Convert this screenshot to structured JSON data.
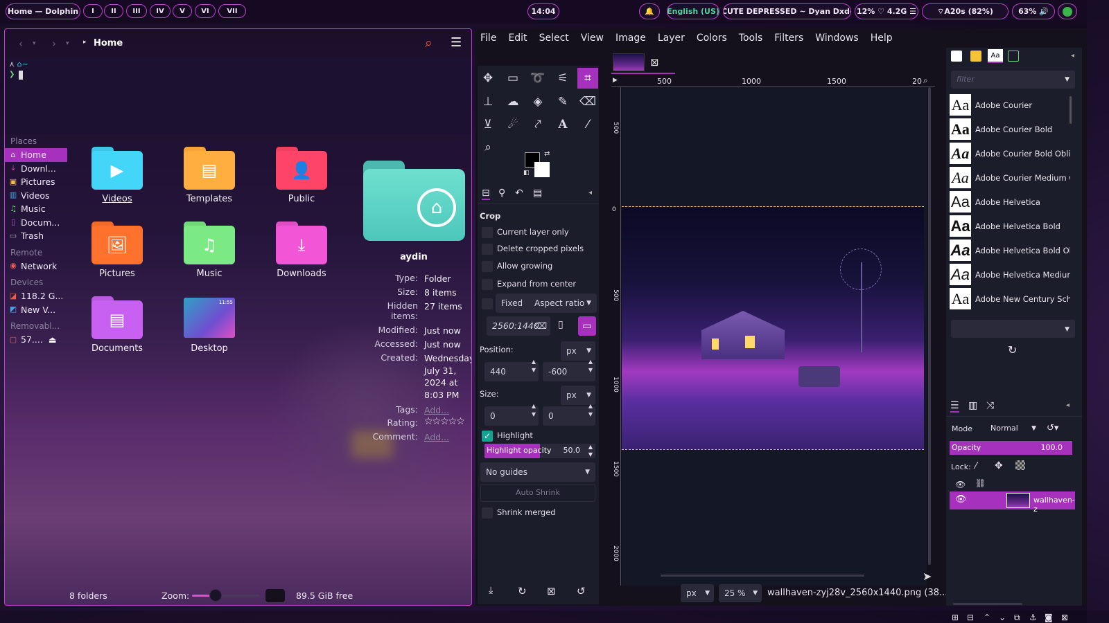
{
  "topbar": {
    "window_title": "Home — Dolphin",
    "workspaces": [
      "I",
      "II",
      "III",
      "IV",
      "V",
      "VI",
      "VII"
    ],
    "clock": "14:04",
    "keyboard": "English (US)",
    "now_playing": "♪ CUTE DEPRESSED ~ Dyan Dxddy",
    "cpu_ram": "12% ♡ 4.2G ☰",
    "wifi": "A20s (82%)",
    "volume": "63% 🔊",
    "colors": {
      "accent": "#c03fd0",
      "bar_bg": "#150a22",
      "power": "#3ab54a"
    }
  },
  "dolphin": {
    "breadcrumb": "Home",
    "terminal": {
      "prompt": "~"
    },
    "places": {
      "header_places": "Places",
      "items": [
        {
          "label": "Home",
          "icon": "home-icon"
        },
        {
          "label": "Downl...",
          "icon": "download-icon"
        },
        {
          "label": "Pictures",
          "icon": "pictures-icon"
        },
        {
          "label": "Videos",
          "icon": "videos-icon"
        },
        {
          "label": "Music",
          "icon": "music-icon"
        },
        {
          "label": "Docum...",
          "icon": "documents-icon"
        },
        {
          "label": "Trash",
          "icon": "trash-icon"
        }
      ],
      "header_remote": "Remote",
      "remote_items": [
        {
          "label": "Network",
          "icon": "network-icon"
        }
      ],
      "header_devices": "Devices",
      "device_items": [
        {
          "label": "118.2 G...",
          "icon": "drive-icon"
        },
        {
          "label": "New V...",
          "icon": "volume-icon"
        }
      ],
      "header_removable": "Removabl...",
      "removable_items": [
        {
          "label": "57....",
          "icon": "usb-icon"
        }
      ]
    },
    "folders": [
      {
        "label": "Videos",
        "color": "#3fc6e6",
        "glyph": "▶"
      },
      {
        "label": "Templates",
        "color": "#f6a23a",
        "glyph": "▤"
      },
      {
        "label": "Public",
        "color": "#f0405f",
        "glyph": "👤"
      },
      {
        "label": "Pictures",
        "color": "#f06a2a",
        "glyph": "🖼"
      },
      {
        "label": "Music",
        "color": "#72d97a",
        "glyph": "♫"
      },
      {
        "label": "Downloads",
        "color": "#e04fc6",
        "glyph": "⤓"
      },
      {
        "label": "Documents",
        "color": "#b95ae0",
        "glyph": "▤"
      },
      {
        "label": "Desktop",
        "color": "#2fa0c6",
        "glyph": "11:55"
      }
    ],
    "info": {
      "name": "aydin",
      "rows": [
        {
          "key": "Type:",
          "value": "Folder"
        },
        {
          "key": "Size:",
          "value": "8 items"
        },
        {
          "key": "Hidden items:",
          "value": "27 items"
        },
        {
          "key": "Modified:",
          "value": "Just now"
        },
        {
          "key": "Accessed:",
          "value": "Just now"
        },
        {
          "key": "Created:",
          "value": "Wednesday, July 31, 2024 at 8:03 PM"
        },
        {
          "key": "Tags:",
          "value": "Add..."
        },
        {
          "key": "Rating:",
          "value": "☆☆☆☆☆"
        },
        {
          "key": "Comment:",
          "value": "Add..."
        }
      ]
    },
    "status": {
      "count": "8 folders",
      "zoom_label": "Zoom:",
      "free": "89.5 GiB free",
      "zoom_level": 0.35
    }
  },
  "gimp": {
    "menu": [
      "File",
      "Edit",
      "Select",
      "View",
      "Image",
      "Layer",
      "Colors",
      "Tools",
      "Filters",
      "Windows",
      "Help"
    ],
    "crop": {
      "title": "Crop",
      "options": [
        "Current layer only",
        "Delete cropped pixels",
        "Allow growing",
        "Expand from center"
      ],
      "fixed_label": "Fixed",
      "fixed_mode": "Aspect ratio",
      "ratio": "2560:1440",
      "position_label": "Position:",
      "unit": "px",
      "pos_x": "440",
      "pos_y": "-600",
      "size_label": "Size:",
      "size_w": "0",
      "size_h": "0",
      "highlight_label": "Highlight",
      "highlight_opacity_label": "Highlight opacity",
      "highlight_opacity": "50.0",
      "guides": "No guides",
      "auto_shrink": "Auto Shrink",
      "shrink_merged": "Shrink merged"
    },
    "ruler_labels": [
      "500",
      "1000",
      "1500",
      "20"
    ],
    "vruler_labels": [
      "500",
      "0",
      "500",
      "1000",
      "1500",
      "2000"
    ],
    "status": {
      "unit": "px",
      "zoom": "25 %",
      "filename": "wallhaven-zyj28v_2560x1440.png (38...."
    },
    "fonts": {
      "filter_placeholder": "filter",
      "items": [
        "Adobe Courier",
        "Adobe Courier Bold",
        "Adobe Courier Bold Oblique",
        "Adobe Courier Medium Obl",
        "Adobe Helvetica",
        "Adobe Helvetica Bold",
        "Adobe Helvetica Bold Obliq",
        "Adobe Helvetica Medium C",
        "Adobe New Century School"
      ]
    },
    "layers": {
      "mode_label": "Mode",
      "mode": "Normal",
      "opacity_label": "Opacity",
      "opacity": "100.0",
      "lock_label": "Lock:",
      "layer_name": "wallhaven-z"
    },
    "colors": {
      "accent": "#a531bd",
      "bg": "#1c1d2a",
      "teal": "#17a393"
    }
  }
}
